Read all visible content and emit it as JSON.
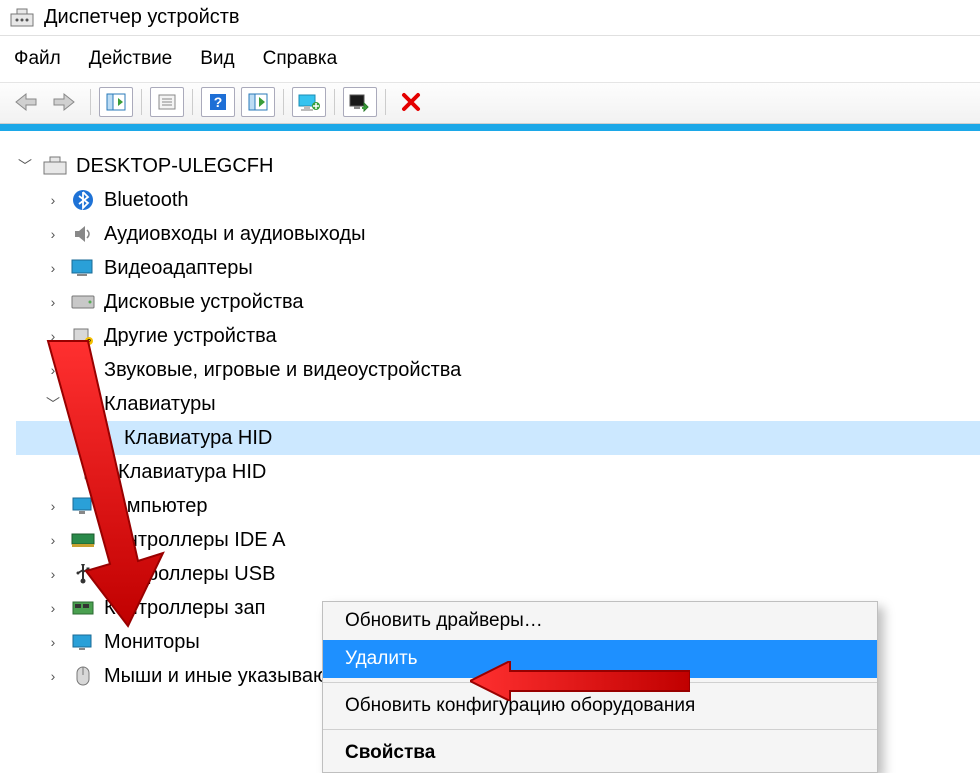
{
  "title": "Диспетчер устройств",
  "menu": {
    "file": "Файл",
    "action": "Действие",
    "view": "Вид",
    "help": "Справка"
  },
  "root": "DESKTOP-ULEGCFH",
  "nodes": {
    "bluetooth": "Bluetooth",
    "audio_io": "Аудиовходы и аудиовыходы",
    "display": "Видеоадаптеры",
    "disk": "Дисковые устройства",
    "other": "Другие устройства",
    "sound": "Звуковые, игровые и видеоустройства",
    "keyboards": "Клавиатуры",
    "kb_hid_1": "Клавиатура HID",
    "kb_hid_2": "Клавиатура HID",
    "computer": "Компьютер",
    "ide": "Контроллеры IDE A",
    "usb": "Контроллеры USB",
    "storage": "Контроллеры зап",
    "monitors": "Мониторы",
    "mice": "Мыши и иные указывающие устройства"
  },
  "ctx": {
    "update": "Обновить драйверы…",
    "delete": "Удалить",
    "scan": "Обновить конфигурацию оборудования",
    "props": "Свойства"
  }
}
